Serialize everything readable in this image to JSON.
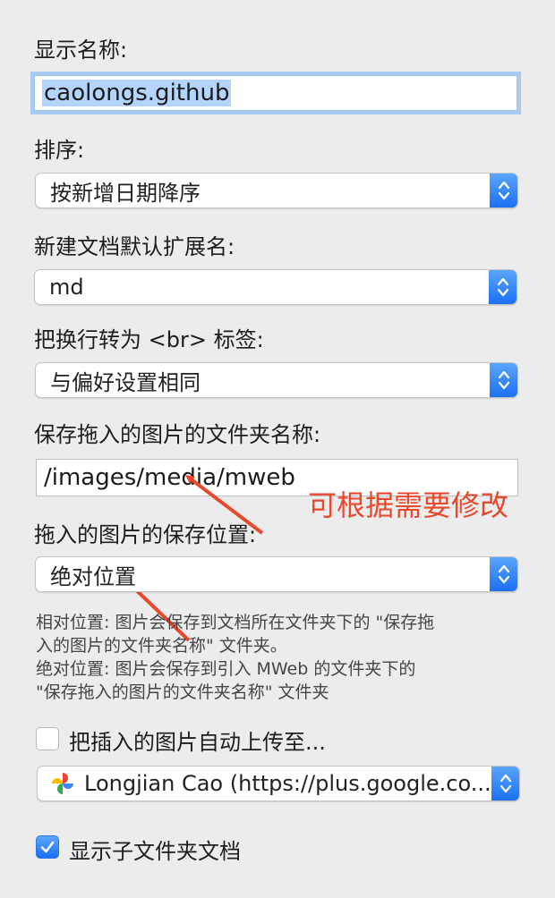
{
  "display_name": {
    "label": "显示名称:",
    "value": "caolongs.github"
  },
  "sort": {
    "label": "排序:",
    "selected": "按新增日期降序"
  },
  "default_extension": {
    "label": "新建文档默认扩展名:",
    "selected": "md"
  },
  "line_break": {
    "label": "把换行转为 <br> 标签:",
    "selected": "与偏好设置相同"
  },
  "image_folder": {
    "label": "保存拖入的图片的文件夹名称:",
    "value": "/images/media/mweb"
  },
  "image_location": {
    "label": "拖入的图片的保存位置:",
    "selected": "绝对位置"
  },
  "help_text": {
    "line1": "相对位置: 图片会保存到文档所在文件夹下的 \"保存拖",
    "line2": "入的图片的文件夹名称\" 文件夹。",
    "line3": "绝对位置: 图片会保存到引入 MWeb 的文件夹下的",
    "line4": "\"保存拖入的图片的文件夹名称\" 文件夹"
  },
  "auto_upload": {
    "label": "把插入的图片自动上传至...",
    "checked": false,
    "service": "Longjian Cao (https://plus.google.co...",
    "service_icon": "google-photos-pinwheel-icon"
  },
  "show_subfolders": {
    "label": "显示子文件夹文档",
    "checked": true
  },
  "annotation": {
    "text": "可根据需要修改",
    "color": "#e8492d"
  },
  "colors": {
    "accent": "#1a6ff4",
    "focus_ring": "#a9cbf1",
    "background": "#ececec"
  }
}
